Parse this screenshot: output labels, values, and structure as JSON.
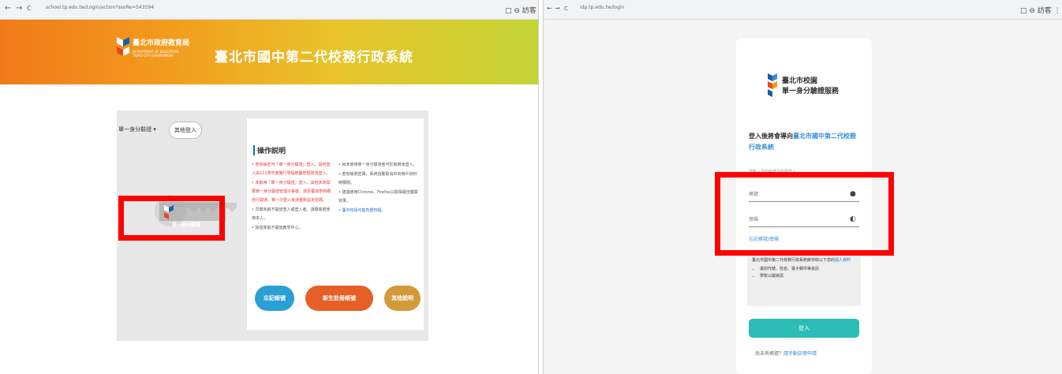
{
  "left": {
    "browser": {
      "url": "school.tp.edu.tw/Login/action?ssoRe=543594",
      "back": "←",
      "forward": "→",
      "reload": "C",
      "icons": "□ ⊖ 訪客"
    },
    "header": {
      "org_name": "臺北市政府教育局",
      "org_sub": "DEPARTMENT OF EDUCATION TAIPEI CITY GOVERNMENT",
      "system_title": "臺北市國中第二代校務行政系統"
    },
    "tabs": {
      "sso": "單一身分驗證 ▾",
      "other": "其他登入"
    },
    "sso_button_label": "單一身分驗證",
    "notice": {
      "title": "操作説明",
      "col1": [
        "• 若有帳密可「單一身分驗證」登入，其他登入由111學年度實行學程統籌管理更改登入。",
        "• 未啟用「單一身分驗證」登入，其他未來需要單一身分驗證管理子帳號，請至臺灣學術網自行開通，等一次登入後請重新設定密碼。",
        "• 早期未啟不開放登入或登入者，請跟帳號使用本人。",
        "• 除個家庭不開放教學中心。"
      ],
      "col2": [
        "• 尚未使用單一身分驗證者可於啟用後登入。",
        "• 若有帳號密碼，系統自動取消中央用戶資料時關閉。",
        "• 建議使用Chrome、Firefox以取得最佳體驗效果。",
        "• 臺中校長可能負重校程。"
      ]
    },
    "buttons": {
      "forgot": "忘記帳號",
      "new_student": "新生註冊帳號",
      "other_info": "其他說明"
    }
  },
  "right": {
    "browser": {
      "url": "idp.tp.edu.tw/login",
      "reload": "C",
      "icons": "□ ⊖ 訪客 ⋮"
    },
    "portal": {
      "name_line1": "臺北市校園",
      "name_line2": "單一身分驗證服務"
    },
    "login_to_prefix": "登入後將會導向",
    "login_to_link": "臺北市國中第二代校務行政系統",
    "hint": "請輸入您的帳號及密碼登入",
    "username_placeholder": "帳號",
    "password_placeholder": "密碼",
    "forgot_link": "忘記帳號/密碼",
    "info": {
      "text": "臺北市國中第二代校務行政系統將存取以下您的",
      "link": "個人資料",
      "items": [
        "識別代號、姓名、電子郵件等資訊",
        "學校公開資訊"
      ]
    },
    "login_button": "登入",
    "no_account_prefix": "尚未有帳號？",
    "no_account_link": "請手動註冊申請"
  },
  "colors": {
    "highlight": "#ff0000",
    "login_button": "#2bbcb7",
    "btn_blue": "#2a9fd6",
    "btn_orange": "#e56027",
    "btn_brown": "#d39a3a"
  }
}
